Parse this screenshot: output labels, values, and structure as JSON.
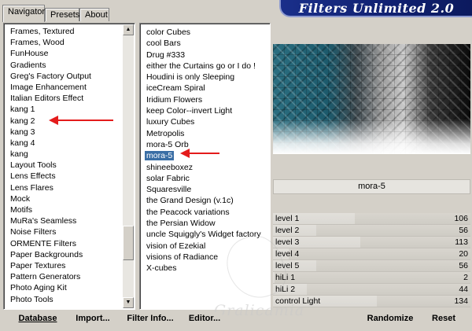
{
  "tabs": [
    {
      "label": "Navigator",
      "active": true
    },
    {
      "label": "Presets",
      "active": false
    },
    {
      "label": "About",
      "active": false
    }
  ],
  "banner": {
    "title": "Filters Unlimited 2.0"
  },
  "categories": [
    "Frames, Textured",
    "Frames, Wood",
    "FunHouse",
    "Gradients",
    "Greg's Factory Output",
    "Image Enhancement",
    "Italian Editors Effect",
    "kang 1",
    "kang 2",
    "kang 3",
    "kang 4",
    "kang",
    "Layout Tools",
    "Lens Effects",
    "Lens Flares",
    "Mock",
    "Motifs",
    "MuRa's Seamless",
    "Noise Filters",
    "ORMENTE Filters",
    "Paper Backgrounds",
    "Paper Textures",
    "Pattern Generators",
    "Photo Aging Kit",
    "Photo Tools"
  ],
  "filters": [
    "color Cubes",
    "cool Bars",
    "Drug #333",
    "either the Curtains go or I do !",
    "Houdini is only Sleeping",
    "iceCream Spiral",
    "Iridium Flowers",
    "keep Color--invert Light",
    "luxury Cubes",
    "Metropolis",
    "mora-5 Orb",
    "mora-5",
    "shineeboxez",
    "solar Fabric",
    "Squaresville",
    "the Grand Design     (v.1c)",
    "the Peacock variations",
    "the Persian Widow",
    "uncle Squiggly's Widget factory",
    "vision of Ezekial",
    "visions of Radiance",
    "X-cubes"
  ],
  "selected_filter": "mora-5",
  "filter_name": "mora-5",
  "sliders": [
    {
      "label": "level 1",
      "value": "106",
      "level": 106
    },
    {
      "label": "level 2",
      "value": "56",
      "level": 56
    },
    {
      "label": "level 3",
      "value": "113",
      "level": 113
    },
    {
      "label": "level 4",
      "value": "20",
      "level": 20
    },
    {
      "label": "level 5",
      "value": "56",
      "level": 56
    },
    {
      "label": "hiLi 1",
      "value": "2",
      "level": 2
    },
    {
      "label": "hiLi 2",
      "value": "44",
      "level": 44
    },
    {
      "label": "control Light",
      "value": "134",
      "level": 134
    }
  ],
  "buttons": {
    "database": "Database",
    "import": "Import...",
    "filter_info": "Filter Info...",
    "editor": "Editor...",
    "randomize": "Randomize",
    "reset": "Reset"
  },
  "watermark": "Gralicamia",
  "colors": {
    "selection": "#3a6ea5",
    "arrow": "#e41b1b",
    "banner": "#102070"
  }
}
